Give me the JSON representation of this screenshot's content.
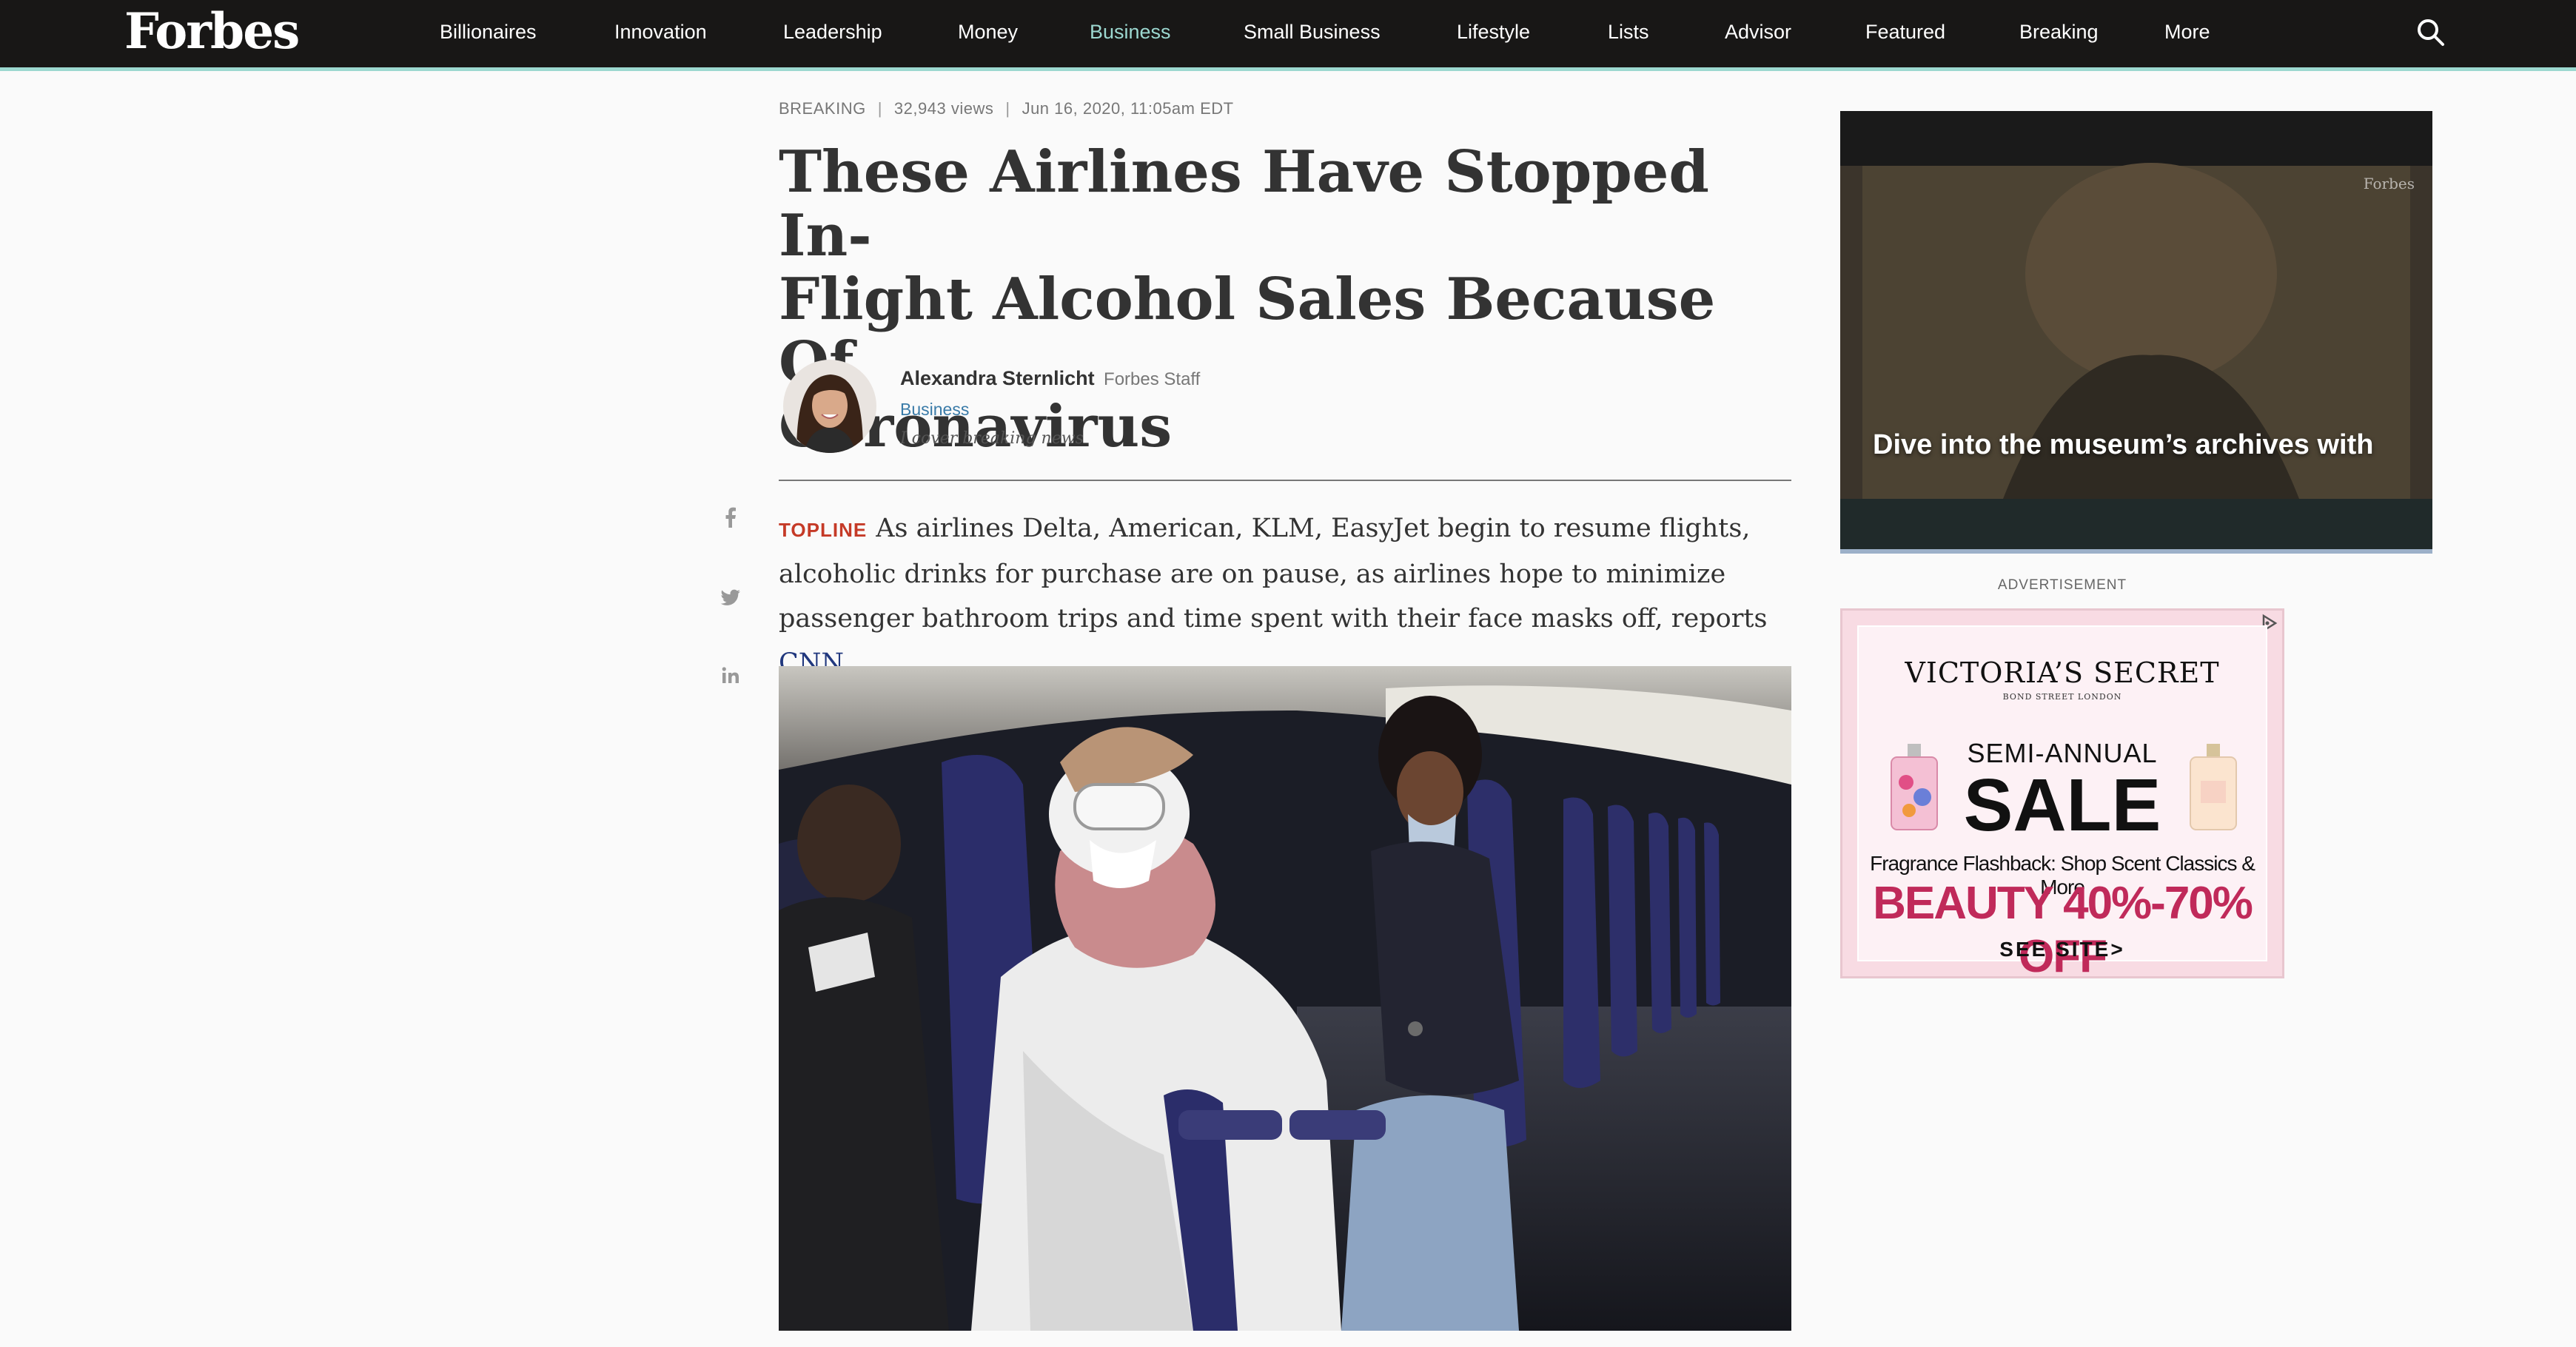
{
  "nav": {
    "logo": "Forbes",
    "items": [
      {
        "label": "Billionaires",
        "active": false
      },
      {
        "label": "Innovation",
        "active": false
      },
      {
        "label": "Leadership",
        "active": false
      },
      {
        "label": "Money",
        "active": false
      },
      {
        "label": "Business",
        "active": true
      },
      {
        "label": "Small Business",
        "active": false
      },
      {
        "label": "Lifestyle",
        "active": false
      },
      {
        "label": "Lists",
        "active": false
      },
      {
        "label": "Advisor",
        "active": false
      },
      {
        "label": "Featured",
        "active": false
      },
      {
        "label": "Breaking",
        "active": false
      },
      {
        "label": "More",
        "active": false
      }
    ],
    "search_icon": "search-icon",
    "accent_color": "#9cd8d0"
  },
  "article": {
    "meta": {
      "section": "BREAKING",
      "views": "32,943 views",
      "date": "Jun 16, 2020, 11:05am EDT"
    },
    "headline_lines": [
      "These Airlines Have Stopped In-",
      "Flight Alcohol Sales Because Of",
      "Coronavirus"
    ],
    "author": {
      "name": "Alexandra Sternlicht",
      "role": "Forbes Staff",
      "section": "Business",
      "bio": "I cover breaking news"
    },
    "share_icons": [
      "facebook-icon",
      "twitter-icon",
      "linkedin-icon"
    ],
    "topline": {
      "label": "TOPLINE",
      "text": "As airlines Delta, American, KLM, EasyJet begin to resume flights, alcoholic drinks for purchase are on pause, as airlines hope to minimize passenger bathroom trips and time spent with their face masks off, reports ",
      "link": "CNN",
      "end": "."
    }
  },
  "sidebar": {
    "video": {
      "caption": "Dive into the museum’s archives with",
      "watermark": "Forbes"
    },
    "ad_label": "ADVERTISEMENT",
    "ad": {
      "brand": "VICTORIA’S SECRET",
      "brand_sub": "BOND STREET LONDON",
      "semi": "SEMI-ANNUAL",
      "sale": "SALE",
      "flash": "Fragrance Flashback: Shop Scent Classics & More",
      "beauty": "BEAUTY 40%-70% OFF",
      "cta": "SEE SITE>"
    }
  }
}
